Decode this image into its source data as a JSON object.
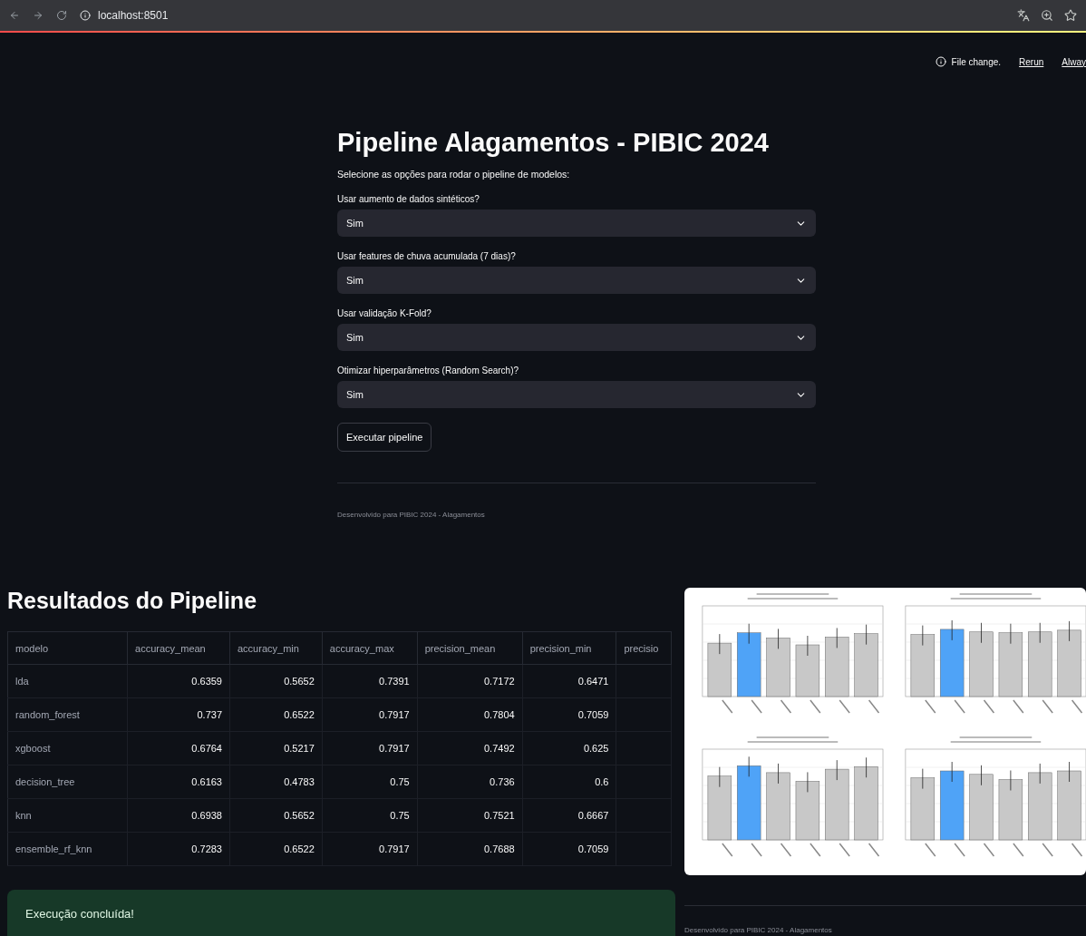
{
  "browser": {
    "url": "localhost:8501"
  },
  "header": {
    "status": "File change.",
    "actions": [
      "Rerun",
      "Alway"
    ]
  },
  "main": {
    "title": "Pipeline Alagamentos - PIBIC 2024",
    "subtitle": "Selecione as opções para rodar o pipeline de modelos:",
    "options": [
      {
        "label": "Usar aumento de dados sintéticos?",
        "value": "Sim"
      },
      {
        "label": "Usar features de chuva acumulada (7 dias)?",
        "value": "Sim"
      },
      {
        "label": "Usar validação K-Fold?",
        "value": "Sim"
      },
      {
        "label": "Otimizar hiperparâmetros (Random Search)?",
        "value": "Sim"
      }
    ],
    "button": "Executar pipeline",
    "footer": "Desenvolvido para PIBIC 2024 - Alagamentos"
  },
  "results": {
    "title": "Resultados do Pipeline",
    "table": {
      "columns": [
        "modelo",
        "accuracy_mean",
        "accuracy_min",
        "accuracy_max",
        "precision_mean",
        "precision_min",
        "precisio"
      ],
      "rows": [
        [
          "lda",
          "0.6359",
          "0.5652",
          "0.7391",
          "0.7172",
          "0.6471"
        ],
        [
          "random_forest",
          "0.737",
          "0.6522",
          "0.7917",
          "0.7804",
          "0.7059"
        ],
        [
          "xgboost",
          "0.6764",
          "0.5217",
          "0.7917",
          "0.7492",
          "0.625"
        ],
        [
          "decision_tree",
          "0.6163",
          "0.4783",
          "0.75",
          "0.736",
          "0.6"
        ],
        [
          "knn",
          "0.6938",
          "0.5652",
          "0.75",
          "0.7521",
          "0.6667"
        ],
        [
          "ensemble_rf_knn",
          "0.7283",
          "0.6522",
          "0.7917",
          "0.7688",
          "0.7059"
        ]
      ]
    },
    "success": "Execução concluída!",
    "footer": "Desenvolvido para PIBIC 2024 - Alagamentos"
  }
}
